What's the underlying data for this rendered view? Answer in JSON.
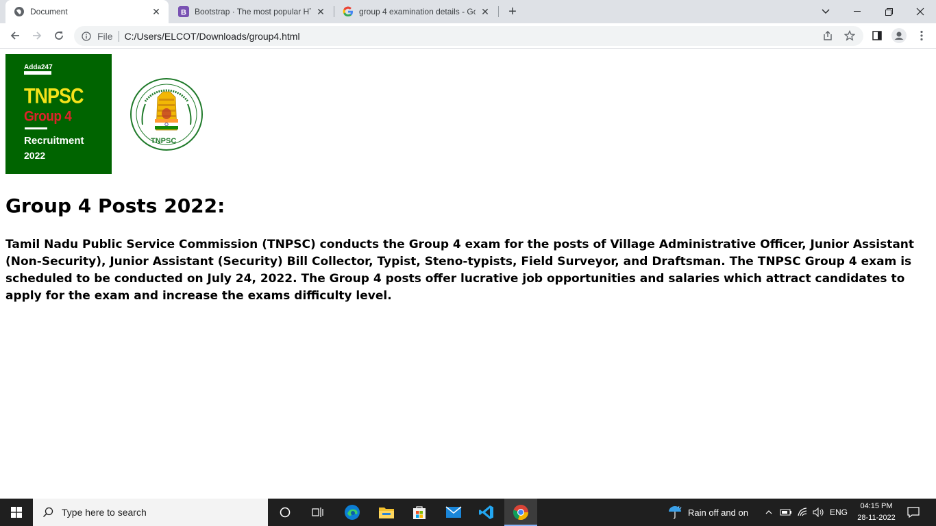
{
  "browser": {
    "tabs": [
      {
        "title": "Document",
        "icon": "globe-icon"
      },
      {
        "title": "Bootstrap · The most popular HTML",
        "icon": "bootstrap-icon"
      },
      {
        "title": "group 4 examination details - Go",
        "icon": "google-icon"
      }
    ],
    "new_tab_label": "+",
    "address": {
      "scheme_label": "File",
      "url": "C:/Users/ELCOT/Downloads/group4.html"
    }
  },
  "page": {
    "banner": {
      "brand": "Adda247",
      "line1": "TNPSC",
      "line2": "Group 4",
      "line3": "Recruitment",
      "line4": "2022"
    },
    "seal_label": "TNPSC",
    "heading": "Group 4 Posts 2022:",
    "paragraph": "Tamil Nadu Public Service Commission (TNPSC) conducts the Group 4 exam for the posts of Village Administrative Officer, Junior Assistant (Non-Security), Junior Assistant (Security) Bill Collector, Typist, Steno-typists, Field Surveyor, and Draftsman. The TNPSC Group 4 exam is scheduled to be conducted on July 24, 2022. The Group 4 posts offer lucrative job opportunities and salaries which attract candidates to apply for the exam and increase the exams difficulty level."
  },
  "taskbar": {
    "search_placeholder": "Type here to search",
    "weather": "Rain off and on",
    "language": "ENG",
    "time": "04:15 PM",
    "date": "28-11-2022"
  },
  "colors": {
    "banner_bg": "#006400",
    "banner_title": "#f5e21a",
    "banner_group": "#e0222a",
    "tabstrip_bg": "#dee1e6",
    "taskbar_bg": "#1f1f1f"
  }
}
